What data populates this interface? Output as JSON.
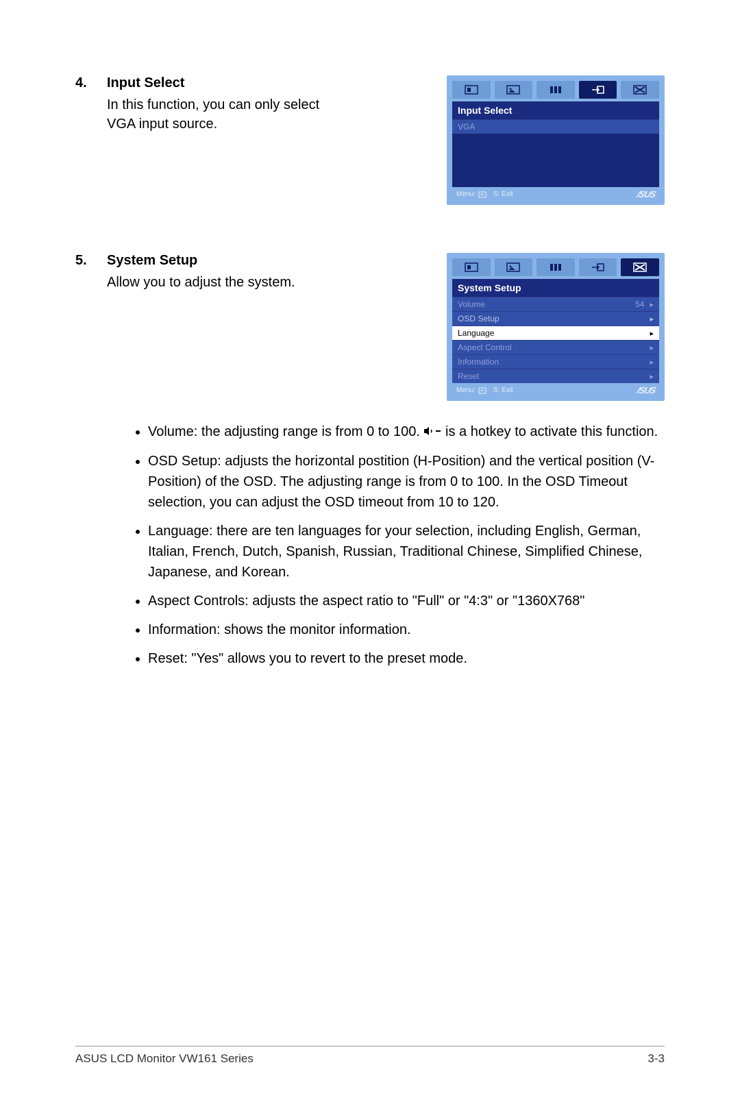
{
  "section4": {
    "number": "4.",
    "title": "Input Select",
    "desc": "In this function, you can only select VGA input source.",
    "osd": {
      "title": "Input Select",
      "rows": [
        {
          "label": "VGA"
        }
      ],
      "foot_menu": "Menu:",
      "foot_exit": "S: Exit",
      "brand": "/SUS"
    }
  },
  "section5": {
    "number": "5.",
    "title": "System Setup",
    "desc": "Allow you to adjust the system.",
    "osd": {
      "title": "System Setup",
      "rows": [
        {
          "label": "Volume",
          "value": "54",
          "sel": false,
          "dim": true
        },
        {
          "label": "OSD Setup",
          "sel": false
        },
        {
          "label": "Language",
          "sel": true
        },
        {
          "label": "Aspect Control",
          "sel": false,
          "dim": true
        },
        {
          "label": "Information",
          "sel": false,
          "dim": true
        },
        {
          "label": "Reset",
          "sel": false,
          "dim": true
        }
      ],
      "foot_menu": "Menu:",
      "foot_exit": "S: Exit",
      "brand": "/SUS"
    }
  },
  "bullets": {
    "b1a": "Volume: the adjusting range is from 0 to 100. ",
    "b1b": " is a hotkey to activate this function.",
    "b2": "OSD Setup: adjusts the horizontal postition (H-Position) and the vertical position (V-Position) of the OSD. The adjusting range is from 0 to 100. In the OSD Timeout selection, you can adjust the OSD timeout from 10 to 120.",
    "b3": "Language: there are ten languages for your selection, including English, German, Italian, French, Dutch, Spanish, Russian, Traditional Chinese, Simplified Chinese, Japanese, and Korean.",
    "b4": "Aspect Controls: adjusts the aspect ratio to \"Full\" or \"4:3\" or \"1360X768\"",
    "b5": "Information: shows the monitor information.",
    "b6": "Reset: \"Yes\" allows you to revert to the preset mode."
  },
  "footer": {
    "left": "ASUS LCD Monitor VW161 Series",
    "right": "3-3"
  }
}
